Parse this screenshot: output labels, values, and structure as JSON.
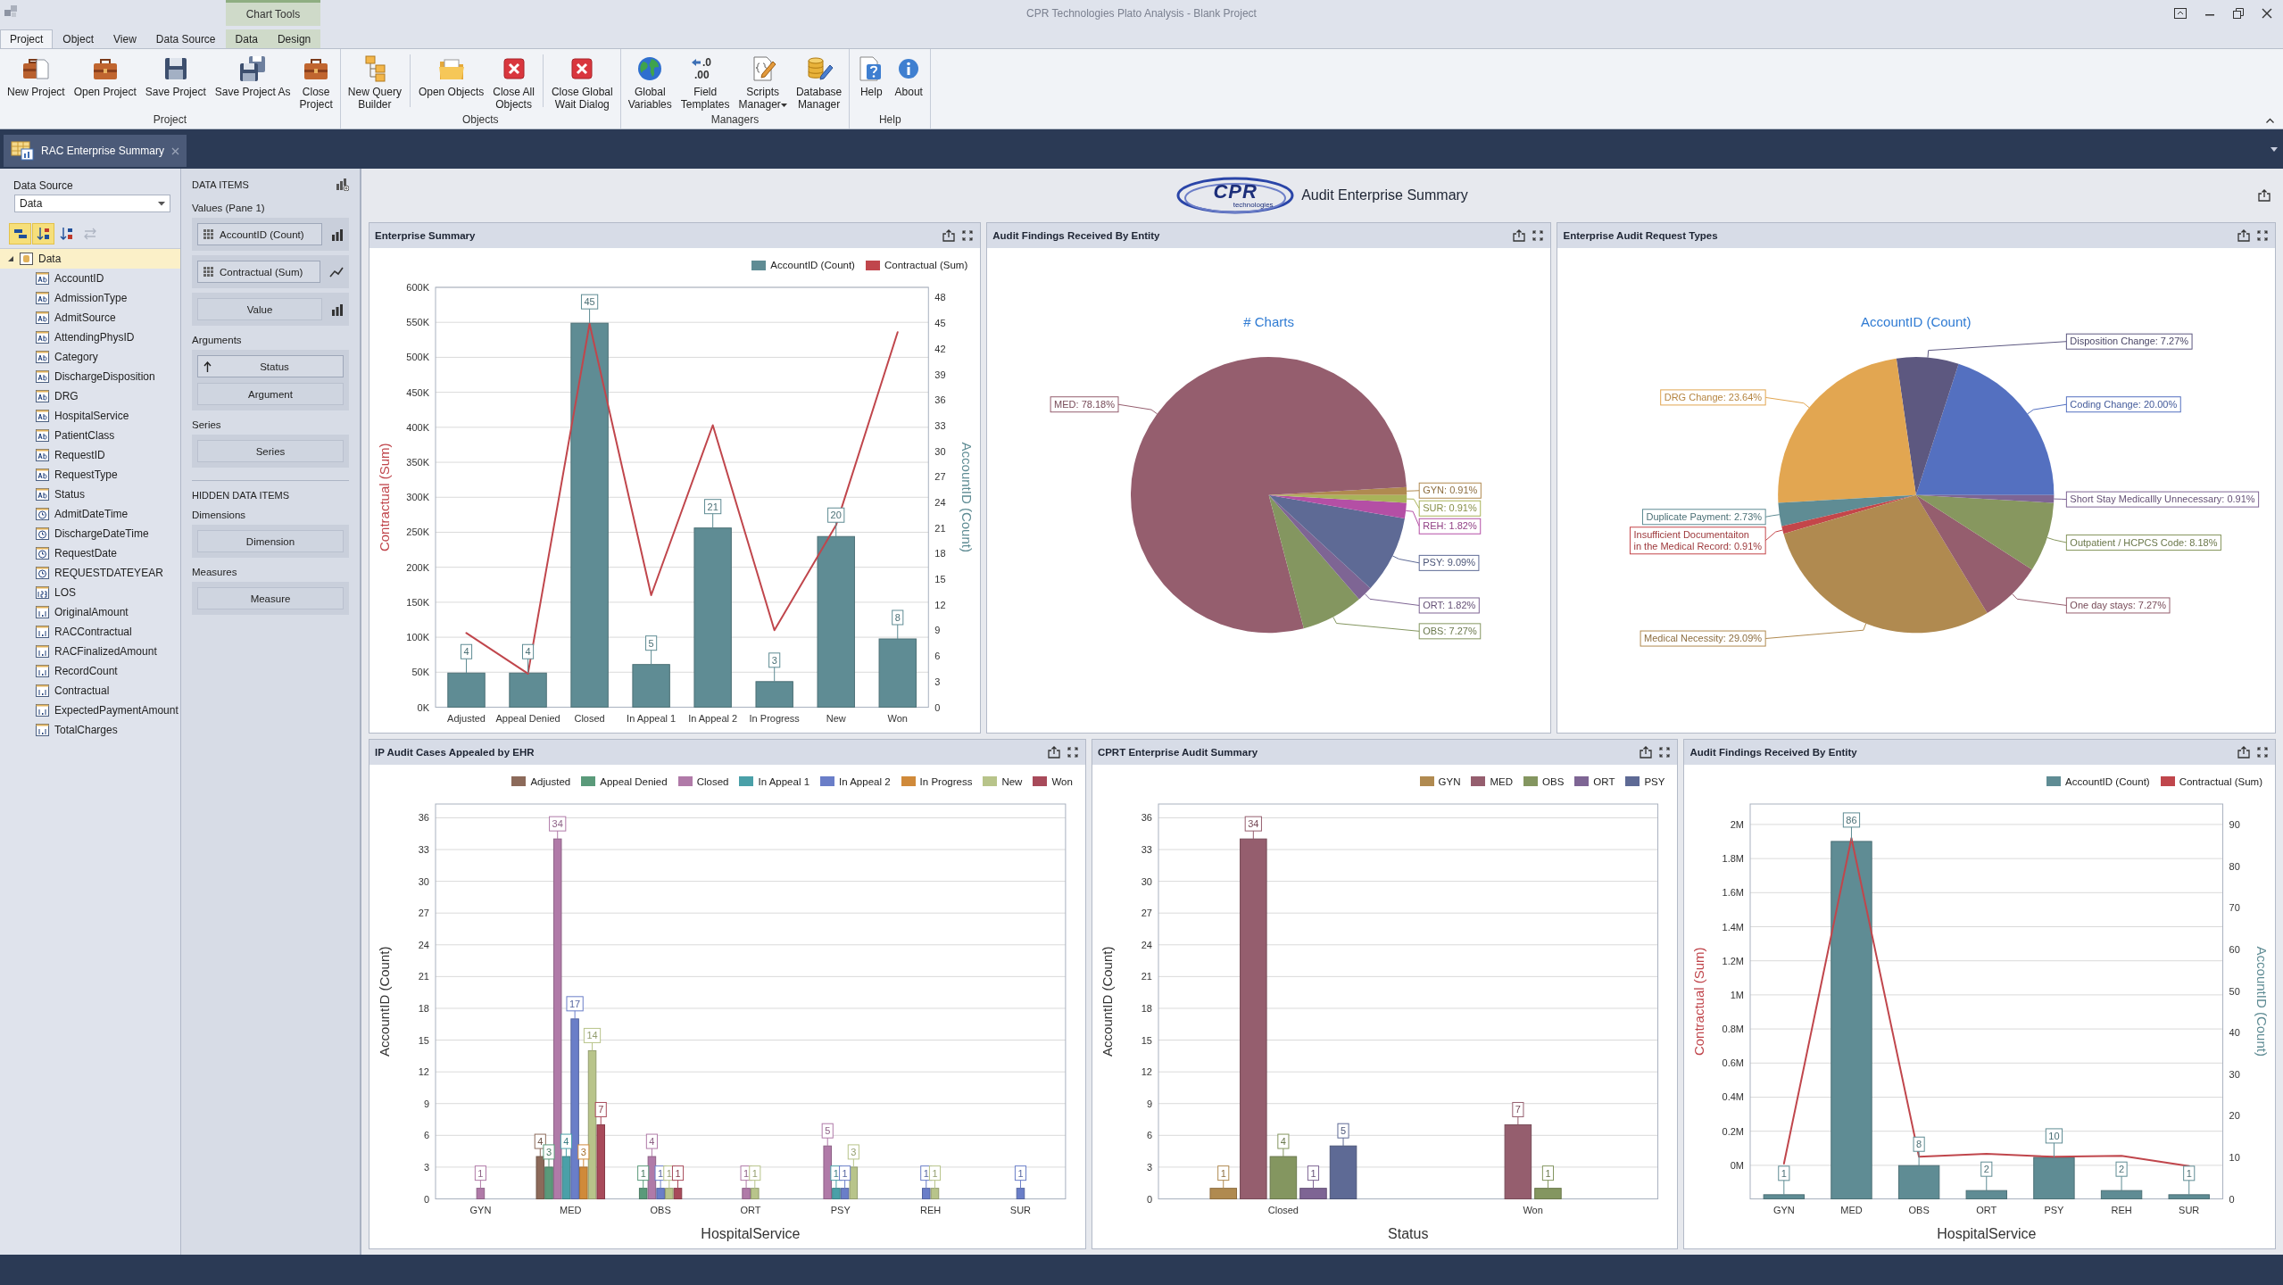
{
  "title_bar": {
    "title": "CPR Technologies Plato Analysis - Blank Project",
    "context_tab_group": "Chart Tools"
  },
  "ribbon": {
    "tabs": [
      {
        "label": "Project",
        "selected": true,
        "contextual": false
      },
      {
        "label": "Object",
        "selected": false,
        "contextual": false
      },
      {
        "label": "View",
        "selected": false,
        "contextual": false
      },
      {
        "label": "Data Source",
        "selected": false,
        "contextual": false
      },
      {
        "label": "Data",
        "selected": false,
        "contextual": true
      },
      {
        "label": "Design",
        "selected": false,
        "contextual": true
      }
    ],
    "groups": [
      {
        "label": "Project",
        "buttons": [
          {
            "label": "New Project",
            "kind": "newcase"
          },
          {
            "label": "Open Project",
            "kind": "case"
          },
          {
            "label": "Save Project",
            "kind": "floppy"
          },
          {
            "label": "Save Project As",
            "kind": "floppyplus"
          },
          {
            "label": "Close\nProject",
            "kind": "case"
          }
        ]
      },
      {
        "label": "Objects",
        "buttons": [
          {
            "label": "New Query\nBuilder",
            "kind": "tree"
          },
          {
            "label": "Open Objects",
            "kind": "folder",
            "separator_before": true
          },
          {
            "label": "Close All\nObjects",
            "kind": "redx"
          },
          {
            "label": "Close Global\nWait Dialog",
            "kind": "redx",
            "separator_before": true
          }
        ]
      },
      {
        "label": "Managers",
        "buttons": [
          {
            "label": "Global\nVariables",
            "kind": "globe"
          },
          {
            "label": "Field\nTemplates",
            "kind": "decimal",
            "icon_text": [
              ".0",
              ".00"
            ]
          },
          {
            "label": "Scripts\nManager",
            "kind": "script",
            "dropdown": true
          },
          {
            "label": "Database\nManager",
            "kind": "database"
          }
        ]
      },
      {
        "label": "Help",
        "buttons": [
          {
            "label": "Help",
            "kind": "helpdoc"
          },
          {
            "label": "About",
            "kind": "info"
          }
        ]
      }
    ]
  },
  "doc_tabs": [
    {
      "label": "RAC Enterprise Summary",
      "selected": true
    }
  ],
  "field_list": {
    "data_source": {
      "label": "Data Source",
      "value": "Data"
    },
    "toolbar": [
      {
        "kind": "group",
        "selected": true,
        "disabled": false
      },
      {
        "kind": "sortaz",
        "selected": true,
        "disabled": false
      },
      {
        "kind": "sortza",
        "selected": false,
        "disabled": false
      },
      {
        "kind": "swap",
        "selected": false,
        "disabled": true
      }
    ],
    "tree": {
      "label": "Data",
      "expanded": true,
      "selected": true,
      "children": [
        {
          "label": "AccountID",
          "kind": "text",
          "selected": false
        },
        {
          "label": "AdmissionType",
          "kind": "text",
          "selected": false
        },
        {
          "label": "AdmitSource",
          "kind": "text",
          "selected": false
        },
        {
          "label": "AttendingPhysID",
          "kind": "text",
          "selected": false
        },
        {
          "label": "Category",
          "kind": "text",
          "selected": false
        },
        {
          "label": "DischargeDisposition",
          "kind": "text",
          "selected": false
        },
        {
          "label": "DRG",
          "kind": "text",
          "selected": false
        },
        {
          "label": "HospitalService",
          "kind": "text",
          "selected": false
        },
        {
          "label": "PatientClass",
          "kind": "text",
          "selected": false
        },
        {
          "label": "RequestID",
          "kind": "text",
          "selected": false
        },
        {
          "label": "RequestType",
          "kind": "text",
          "selected": false
        },
        {
          "label": "Status",
          "kind": "text",
          "selected": false
        },
        {
          "label": "AdmitDateTime",
          "kind": "date",
          "selected": false
        },
        {
          "label": "DischargeDateTime",
          "kind": "date",
          "selected": false
        },
        {
          "label": "RequestDate",
          "kind": "date",
          "selected": false
        },
        {
          "label": "REQUESTDATEYEAR",
          "kind": "date",
          "selected": false
        },
        {
          "label": "LOS",
          "kind": "integer",
          "selected": false
        },
        {
          "label": "OriginalAmount",
          "kind": "decimal",
          "selected": false
        },
        {
          "label": "RACContractual",
          "kind": "decimal",
          "selected": false
        },
        {
          "label": "RACFinalizedAmount",
          "kind": "decimal",
          "selected": false
        },
        {
          "label": "RecordCount",
          "kind": "decimal",
          "selected": false
        },
        {
          "label": "Contractual",
          "kind": "decimal",
          "selected": false
        },
        {
          "label": "ExpectedPaymentAmount",
          "kind": "decimal",
          "selected": false
        },
        {
          "label": "TotalCharges",
          "kind": "decimal",
          "selected": false
        }
      ]
    }
  },
  "data_items": {
    "title": "DATA ITEMS",
    "sections": [
      {
        "label": "Values (Pane 1)",
        "groups": [
          {
            "items": [
              {
                "label": "AccountID (Count)",
                "kind": "value",
                "line_series": false
              }
            ]
          },
          {
            "items": [
              {
                "label": "Contractual (Sum)",
                "kind": "value",
                "line_series": true
              }
            ]
          },
          {
            "items": [
              {
                "label": "Value",
                "kind": "placeholder",
                "line_series": false
              }
            ]
          }
        ]
      },
      {
        "label": "Arguments",
        "groups": [
          {
            "items": [
              {
                "label": "Status",
                "kind": "argument"
              },
              {
                "label": "Argument",
                "kind": "placeholder"
              }
            ]
          }
        ]
      },
      {
        "label": "Series",
        "groups": [
          {
            "items": [
              {
                "label": "Series",
                "kind": "placeholder"
              }
            ]
          }
        ]
      }
    ],
    "hidden_title": "HIDDEN DATA ITEMS",
    "hidden_sections": [
      {
        "label": "Dimensions",
        "groups": [
          {
            "items": [
              {
                "label": "Dimension",
                "kind": "placeholder"
              }
            ]
          }
        ]
      },
      {
        "label": "Measures",
        "groups": [
          {
            "items": [
              {
                "label": "Measure",
                "kind": "placeholder"
              }
            ]
          }
        ]
      }
    ]
  },
  "dashboard": {
    "logo": {
      "name": "CPR",
      "tagline": "technologies"
    },
    "title": "Audit Enterprise Summary",
    "panels": [
      {
        "title": "Enterprise Summary",
        "chart_data": {
          "type": "bar",
          "categories": [
            "Adjusted",
            "Appeal Denied",
            "Closed",
            "In Appeal 1",
            "In Appeal 2",
            "In Progress",
            "New",
            "Won"
          ],
          "grid": true,
          "series": [
            {
              "name": "AccountID (Count)",
              "color": "#5f8c94",
              "type": "bar",
              "axis": "y2",
              "values": [
                4,
                4,
                45,
                5,
                21,
                3,
                20,
                8
              ],
              "value_labels": [
                "4",
                "4",
                "45",
                "5",
                "21",
                "3",
                "20",
                "8"
              ]
            },
            {
              "name": "Contractual (Sum)",
              "color": "#c0464c",
              "type": "line",
              "values": [
                106000,
                48000,
                548000,
                160000,
                403000,
                110000,
                260000,
                536000
              ]
            }
          ],
          "ylabel": "Contractual (Sum)",
          "ylim": [
            0,
            600000
          ],
          "yticks": [
            {
              "value": 0,
              "label": "0K"
            },
            {
              "value": 50000,
              "label": "50K"
            },
            {
              "value": 100000,
              "label": "100K"
            },
            {
              "value": 150000,
              "label": "150K"
            },
            {
              "value": 200000,
              "label": "200K"
            },
            {
              "value": 250000,
              "label": "250K"
            },
            {
              "value": 300000,
              "label": "300K"
            },
            {
              "value": 350000,
              "label": "350K"
            },
            {
              "value": 400000,
              "label": "400K"
            },
            {
              "value": 450000,
              "label": "450K"
            },
            {
              "value": 500000,
              "label": "500K"
            },
            {
              "value": 550000,
              "label": "550K"
            },
            {
              "value": 600000,
              "label": "600K"
            }
          ],
          "y2label": "AccountID (Count)",
          "y2lim": [
            0,
            49.2
          ],
          "y2ticks": [
            0,
            3,
            6,
            9,
            12,
            15,
            18,
            21,
            24,
            27,
            30,
            33,
            36,
            39,
            42,
            45,
            48
          ]
        }
      },
      {
        "title": "Audit Findings Received By Entity",
        "chart_data": {
          "type": "pie",
          "title": "# Charts",
          "categories": [
            "GYN",
            "MED",
            "OBS",
            "ORT",
            "PSY",
            "REH",
            "SUR"
          ],
          "values": [
            0.91,
            78.18,
            7.27,
            1.82,
            9.09,
            1.82,
            0.91
          ],
          "colors": [
            "#b08a50",
            "#955e6e",
            "#849660",
            "#7e6594",
            "#5e6a95",
            "#b44fa5",
            "#a9b35a"
          ],
          "value_labels": [
            ": 0.91%",
            ": 78.18%",
            ": 7.27%",
            ": 1.82%",
            ": 9.09%",
            ": 1.82%",
            ": 0.91%"
          ]
        }
      },
      {
        "title": "Enterprise Audit Request Types",
        "chart_data": {
          "type": "pie",
          "title": "AccountID (Count)",
          "categories": [
            "Coding Change",
            "Disposition Change",
            "DRG Change",
            "Duplicate Payment",
            "Insufficient Documentaiton in the Medical Record",
            "Medical Necessity",
            "One day stays",
            "Outpatient / HCPCS Code",
            "Short Stay Medicallly Unnecessary"
          ],
          "values": [
            20.0,
            7.27,
            23.64,
            2.73,
            0.91,
            29.09,
            7.27,
            8.18,
            0.91
          ],
          "colors": [
            "#5470c0",
            "#5d5880",
            "#e2a651",
            "#5f8c94",
            "#c4464a",
            "#b08a50",
            "#955e6e",
            "#87975f",
            "#7e6594"
          ],
          "value_labels": [
            ": 20.00%",
            ": 7.27%",
            ": 23.64%",
            ": 2.73%",
            ": 0.91%",
            ": 29.09%",
            ": 7.27%",
            ": 8.18%",
            ": 0.91%"
          ]
        }
      },
      {
        "title": "IP Audit Cases Appealed by EHR",
        "chart_data": {
          "type": "bar",
          "grid": true,
          "categories": [
            "GYN",
            "MED",
            "OBS",
            "ORT",
            "PSY",
            "REH",
            "SUR"
          ],
          "series": [
            {
              "name": "Adjusted",
              "color": "#8c6a5a",
              "values": [
                null,
                4,
                null,
                null,
                null,
                null,
                null
              ]
            },
            {
              "name": "Appeal Denied",
              "color": "#5a9a7a",
              "values": [
                null,
                3,
                1,
                null,
                null,
                null,
                null
              ]
            },
            {
              "name": "Closed",
              "color": "#b07aa8",
              "values": [
                1,
                34,
                4,
                1,
                5,
                null,
                null
              ]
            },
            {
              "name": "In Appeal 1",
              "color": "#4aa0a8",
              "values": [
                null,
                4,
                null,
                null,
                1,
                null,
                null
              ]
            },
            {
              "name": "In Appeal 2",
              "color": "#6a7ec8",
              "values": [
                null,
                17,
                1,
                null,
                1,
                1,
                1
              ]
            },
            {
              "name": "In Progress",
              "color": "#d08a3a",
              "values": [
                null,
                3,
                null,
                null,
                null,
                null,
                null
              ]
            },
            {
              "name": "New",
              "color": "#b8c48a",
              "values": [
                null,
                14,
                1,
                1,
                3,
                1,
                null
              ]
            },
            {
              "name": "Won",
              "color": "#a84a5a",
              "values": [
                null,
                7,
                1,
                null,
                null,
                null,
                null
              ]
            }
          ],
          "xlabel": "HospitalService",
          "ylabel": "AccountID (Count)",
          "ylim": [
            0,
            37.3
          ],
          "yticks": [
            0,
            3,
            6,
            9,
            12,
            15,
            18,
            21,
            24,
            27,
            30,
            33,
            36
          ],
          "data_labels": true
        }
      },
      {
        "title": "CPRT Enterprise Audit Summary",
        "chart_data": {
          "type": "bar",
          "grid": true,
          "categories": [
            "Closed",
            "Won"
          ],
          "series": [
            {
              "name": "GYN",
              "color": "#b08a50",
              "values": [
                1,
                null
              ]
            },
            {
              "name": "MED",
              "color": "#955e6e",
              "values": [
                34,
                7
              ]
            },
            {
              "name": "OBS",
              "color": "#849660",
              "values": [
                4,
                1
              ]
            },
            {
              "name": "ORT",
              "color": "#7e6594",
              "values": [
                1,
                null
              ]
            },
            {
              "name": "PSY",
              "color": "#5e6a95",
              "values": [
                5,
                null
              ]
            }
          ],
          "xlabel": "Status",
          "ylabel": "AccountID (Count)",
          "ylim": [
            0,
            37.3
          ],
          "yticks": [
            0,
            3,
            6,
            9,
            12,
            15,
            18,
            21,
            24,
            27,
            30,
            33,
            36
          ],
          "data_labels": true
        }
      },
      {
        "title": "Audit Findings Received By Entity",
        "chart_data": {
          "type": "bar",
          "categories": [
            "GYN",
            "MED",
            "OBS",
            "ORT",
            "PSY",
            "REH",
            "SUR"
          ],
          "grid": true,
          "series": [
            {
              "name": "AccountID (Count)",
              "color": "#5f8c94",
              "type": "bar",
              "axis": "y2",
              "values": [
                1,
                86,
                8,
                2,
                10,
                2,
                1
              ],
              "value_labels": [
                "1",
                "86",
                "8",
                "2",
                "10",
                "2",
                "1"
              ]
            },
            {
              "name": "Contractual (Sum)",
              "color": "#c0464c",
              "type": "line",
              "values": [
                10000,
                1920000,
                50000,
                67000,
                50000,
                56000,
                -5000
              ]
            }
          ],
          "xlabel": "HospitalService",
          "ylabel": "Contractual (Sum)",
          "ylim": [
            -197000,
            2120000
          ],
          "yticks": [
            {
              "value": 0,
              "label": "0M"
            },
            {
              "value": 200000,
              "label": "0.2M"
            },
            {
              "value": 400000,
              "label": "0.4M"
            },
            {
              "value": 600000,
              "label": "0.6M"
            },
            {
              "value": 800000,
              "label": "0.8M"
            },
            {
              "value": 1000000,
              "label": "1M"
            },
            {
              "value": 1200000,
              "label": "1.2M"
            },
            {
              "value": 1400000,
              "label": "1.4M"
            },
            {
              "value": 1600000,
              "label": "1.6M"
            },
            {
              "value": 1800000,
              "label": "1.8M"
            },
            {
              "value": 2000000,
              "label": "2M"
            }
          ],
          "y2label": "AccountID (Count)",
          "y2lim": [
            0,
            95
          ],
          "y2ticks": [
            0,
            10,
            20,
            30,
            40,
            50,
            60,
            70,
            80,
            90
          ]
        }
      }
    ]
  }
}
